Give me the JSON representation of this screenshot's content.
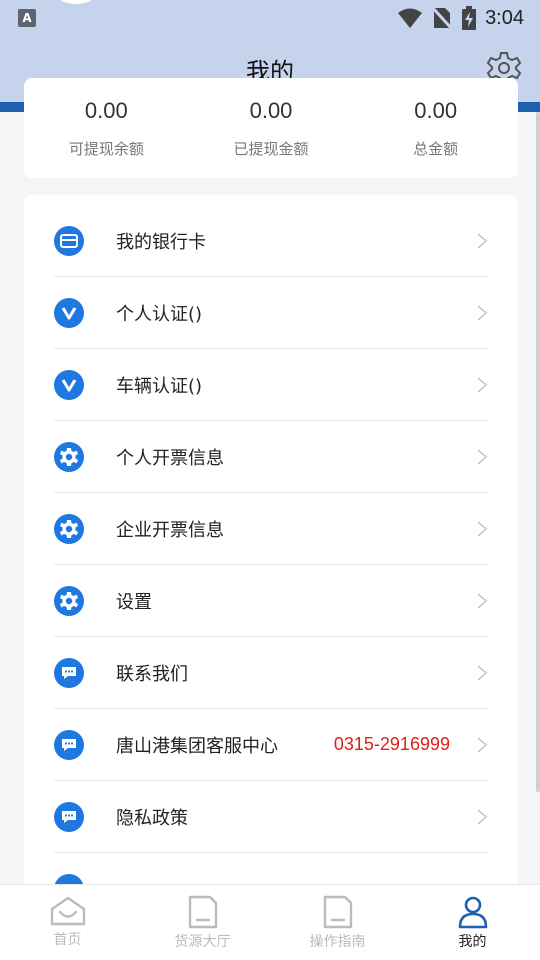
{
  "status_bar": {
    "time": "3:04",
    "indicator": "A"
  },
  "page": {
    "title": "我的"
  },
  "balance": [
    {
      "value": "0.00",
      "label": "可提现余额"
    },
    {
      "value": "0.00",
      "label": "已提现金额"
    },
    {
      "value": "0.00",
      "label": "总金额"
    }
  ],
  "menu": [
    {
      "label": "我的银行卡",
      "icon": "card-icon"
    },
    {
      "label": "个人认证()",
      "icon": "verified-v-icon"
    },
    {
      "label": "车辆认证()",
      "icon": "verified-v-icon"
    },
    {
      "label": "个人开票信息",
      "icon": "gear-icon"
    },
    {
      "label": "企业开票信息",
      "icon": "gear-icon"
    },
    {
      "label": "设置",
      "icon": "gear-icon"
    },
    {
      "label": "联系我们",
      "icon": "chat-icon"
    },
    {
      "label": "唐山港集团客服中心",
      "icon": "chat-icon",
      "value": "0315-2916999"
    },
    {
      "label": "隐私政策",
      "icon": "chat-icon"
    }
  ],
  "bottom_nav": [
    {
      "label": "首页",
      "icon": "home-smile-icon"
    },
    {
      "label": "货源大厅",
      "icon": "document-icon"
    },
    {
      "label": "操作指南",
      "icon": "document-icon"
    },
    {
      "label": "我的",
      "icon": "user-icon",
      "active": true
    }
  ],
  "colors": {
    "accent": "#1f78e0",
    "header": "#c5d4ec",
    "phone": "#e0201a"
  }
}
